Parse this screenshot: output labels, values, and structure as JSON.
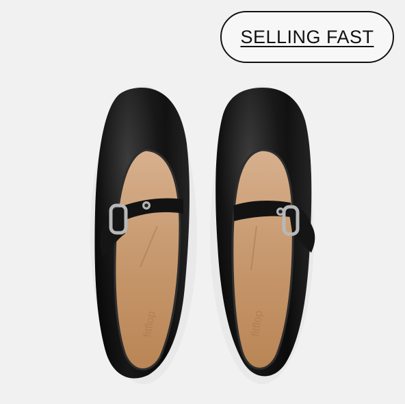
{
  "badge": {
    "label": "SELLING FAST"
  },
  "product": {
    "image_icon": "black-mary-jane-flats-pair"
  },
  "colors": {
    "background": "#f1f1f1",
    "shoe_leather": "#111111",
    "insole": "#c89b73",
    "badge_border": "#111111"
  }
}
